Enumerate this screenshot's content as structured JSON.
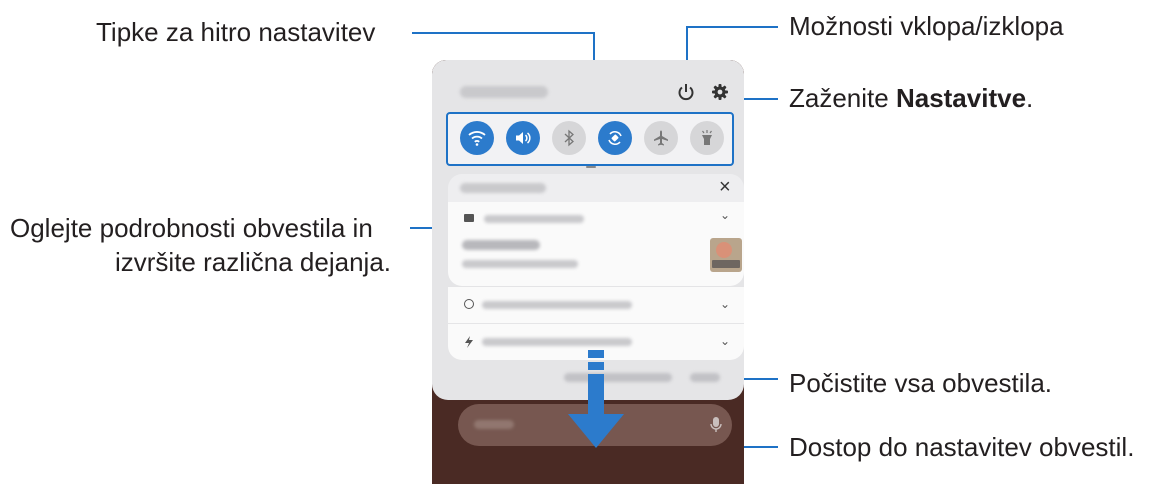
{
  "labels": {
    "quick_buttons": "Tipke za hitro nastavitev",
    "power_options": "Možnosti vklopa/izklopa",
    "launch_settings_prefix": "Zaženite ",
    "launch_settings_bold": "Nastavitve",
    "launch_settings_suffix": ".",
    "details_line1": "Oglejte podrobnosti obvestila in",
    "details_line2": "izvršite različna dejanja.",
    "clear_all": "Počistite vsa obvestila.",
    "notification_settings": "Dostop do nastavitev obvestil."
  },
  "phone": {
    "close_glyph": "×",
    "chevron_glyph": "⌄",
    "quick_settings": [
      {
        "icon": "wifi-icon",
        "state": "on"
      },
      {
        "icon": "sound-icon",
        "state": "on"
      },
      {
        "icon": "bluetooth-icon",
        "state": "off"
      },
      {
        "icon": "auto-rotate-icon",
        "state": "on"
      },
      {
        "icon": "airplane-icon",
        "state": "off"
      },
      {
        "icon": "flashlight-icon",
        "state": "off"
      }
    ]
  },
  "colors": {
    "accent": "#1e72c6",
    "button_on": "#2c7bcc",
    "panel": "#e5e5e7",
    "wallpaper": "#4a2a24"
  }
}
